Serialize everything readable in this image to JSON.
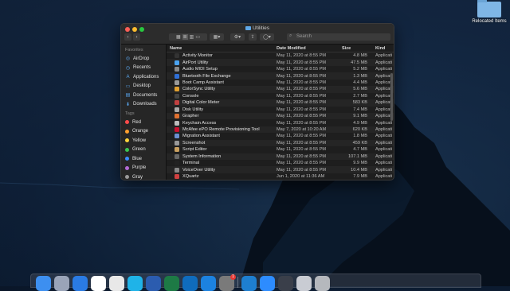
{
  "desktop": {
    "icon_label": "Relocated Items"
  },
  "window": {
    "title": "Utilities",
    "search_placeholder": "Search"
  },
  "sidebar": {
    "favorites_header": "Favorites",
    "favorites": [
      {
        "label": "AirDrop",
        "icon": "airdrop-icon"
      },
      {
        "label": "Recents",
        "icon": "clock-icon"
      },
      {
        "label": "Applications",
        "icon": "applications-icon"
      },
      {
        "label": "Desktop",
        "icon": "desktop-icon"
      },
      {
        "label": "Documents",
        "icon": "document-icon"
      },
      {
        "label": "Downloads",
        "icon": "download-icon"
      }
    ],
    "tags_header": "Tags",
    "tags": [
      {
        "label": "Red",
        "color": "#ff4b4b"
      },
      {
        "label": "Orange",
        "color": "#ff9f2e"
      },
      {
        "label": "Yellow",
        "color": "#ffd43b"
      },
      {
        "label": "Green",
        "color": "#3bc651"
      },
      {
        "label": "Blue",
        "color": "#3b8bff"
      },
      {
        "label": "Purple",
        "color": "#b46bd6"
      },
      {
        "label": "Gray",
        "color": "#9a9a9a"
      }
    ]
  },
  "table": {
    "headers": {
      "name": "Name",
      "date": "Date Modified",
      "size": "Size",
      "kind": "Kind"
    },
    "rows": [
      {
        "name": "Activity Monitor",
        "date": "May 11, 2020 at 8:55 PM",
        "size": "4.8 MB",
        "kind": "Applicati",
        "color": "#333"
      },
      {
        "name": "AirPort Utility",
        "date": "May 11, 2020 at 8:55 PM",
        "size": "47.5 MB",
        "kind": "Applicati",
        "color": "#4aa3f0"
      },
      {
        "name": "Audio MIDI Setup",
        "date": "May 11, 2020 at 8:55 PM",
        "size": "5.2 MB",
        "kind": "Applicati",
        "color": "#888"
      },
      {
        "name": "Bluetooth File Exchange",
        "date": "May 11, 2020 at 8:55 PM",
        "size": "1.3 MB",
        "kind": "Applicati",
        "color": "#2f6fd6"
      },
      {
        "name": "Boot Camp Assistant",
        "date": "May 11, 2020 at 8:55 PM",
        "size": "4.4 MB",
        "kind": "Applicati",
        "color": "#999"
      },
      {
        "name": "ColorSync Utility",
        "date": "May 11, 2020 at 8:55 PM",
        "size": "5.6 MB",
        "kind": "Applicati",
        "color": "#e0a030"
      },
      {
        "name": "Console",
        "date": "May 11, 2020 at 8:55 PM",
        "size": "2.7 MB",
        "kind": "Applicati",
        "color": "#444"
      },
      {
        "name": "Digital Color Meter",
        "date": "May 11, 2020 at 8:55 PM",
        "size": "583 KB",
        "kind": "Applicati",
        "color": "#c04040"
      },
      {
        "name": "Disk Utility",
        "date": "May 11, 2020 at 8:55 PM",
        "size": "7.4 MB",
        "kind": "Applicati",
        "color": "#aaa"
      },
      {
        "name": "Grapher",
        "date": "May 11, 2020 at 8:55 PM",
        "size": "9.1 MB",
        "kind": "Applicati",
        "color": "#e07030"
      },
      {
        "name": "Keychain Access",
        "date": "May 11, 2020 at 8:55 PM",
        "size": "4.9 MB",
        "kind": "Applicati",
        "color": "#bbb"
      },
      {
        "name": "McAfee ePO Remote Provisioning Tool",
        "date": "May 7, 2020 at 10:20 AM",
        "size": "620 KB",
        "kind": "Applicati",
        "color": "#c8102e"
      },
      {
        "name": "Migration Assistant",
        "date": "May 11, 2020 at 8:55 PM",
        "size": "1.8 MB",
        "kind": "Applicati",
        "color": "#6a8fd0"
      },
      {
        "name": "Screenshot",
        "date": "May 11, 2020 at 8:55 PM",
        "size": "459 KB",
        "kind": "Applicati",
        "color": "#999"
      },
      {
        "name": "Script Editor",
        "date": "May 11, 2020 at 8:55 PM",
        "size": "4.7 MB",
        "kind": "Applicati",
        "color": "#c9a060"
      },
      {
        "name": "System Information",
        "date": "May 11, 2020 at 8:55 PM",
        "size": "107.1 MB",
        "kind": "Applicati",
        "color": "#666"
      },
      {
        "name": "Terminal",
        "date": "May 11, 2020 at 8:55 PM",
        "size": "9.9 MB",
        "kind": "Applicati",
        "color": "#222"
      },
      {
        "name": "VoiceOver Utility",
        "date": "May 11, 2020 at 8:55 PM",
        "size": "10.4 MB",
        "kind": "Applicati",
        "color": "#888"
      },
      {
        "name": "XQuartz",
        "date": "Jun 1, 2020 at 11:36 AM",
        "size": "7.9 MB",
        "kind": "Applicati",
        "color": "#d04040"
      }
    ]
  },
  "dock": {
    "items": [
      "finder-icon",
      "launchpad-icon",
      "safari-icon",
      "slack-icon",
      "chrome-icon",
      "pycharm-icon",
      "word-icon",
      "excel-icon",
      "outlook-icon",
      "xcode-icon",
      "system-preferences-icon",
      "vscode-icon",
      "zoom-icon",
      "quicktime-icon",
      "preview-icon",
      "trash-icon"
    ],
    "badge": "1"
  }
}
